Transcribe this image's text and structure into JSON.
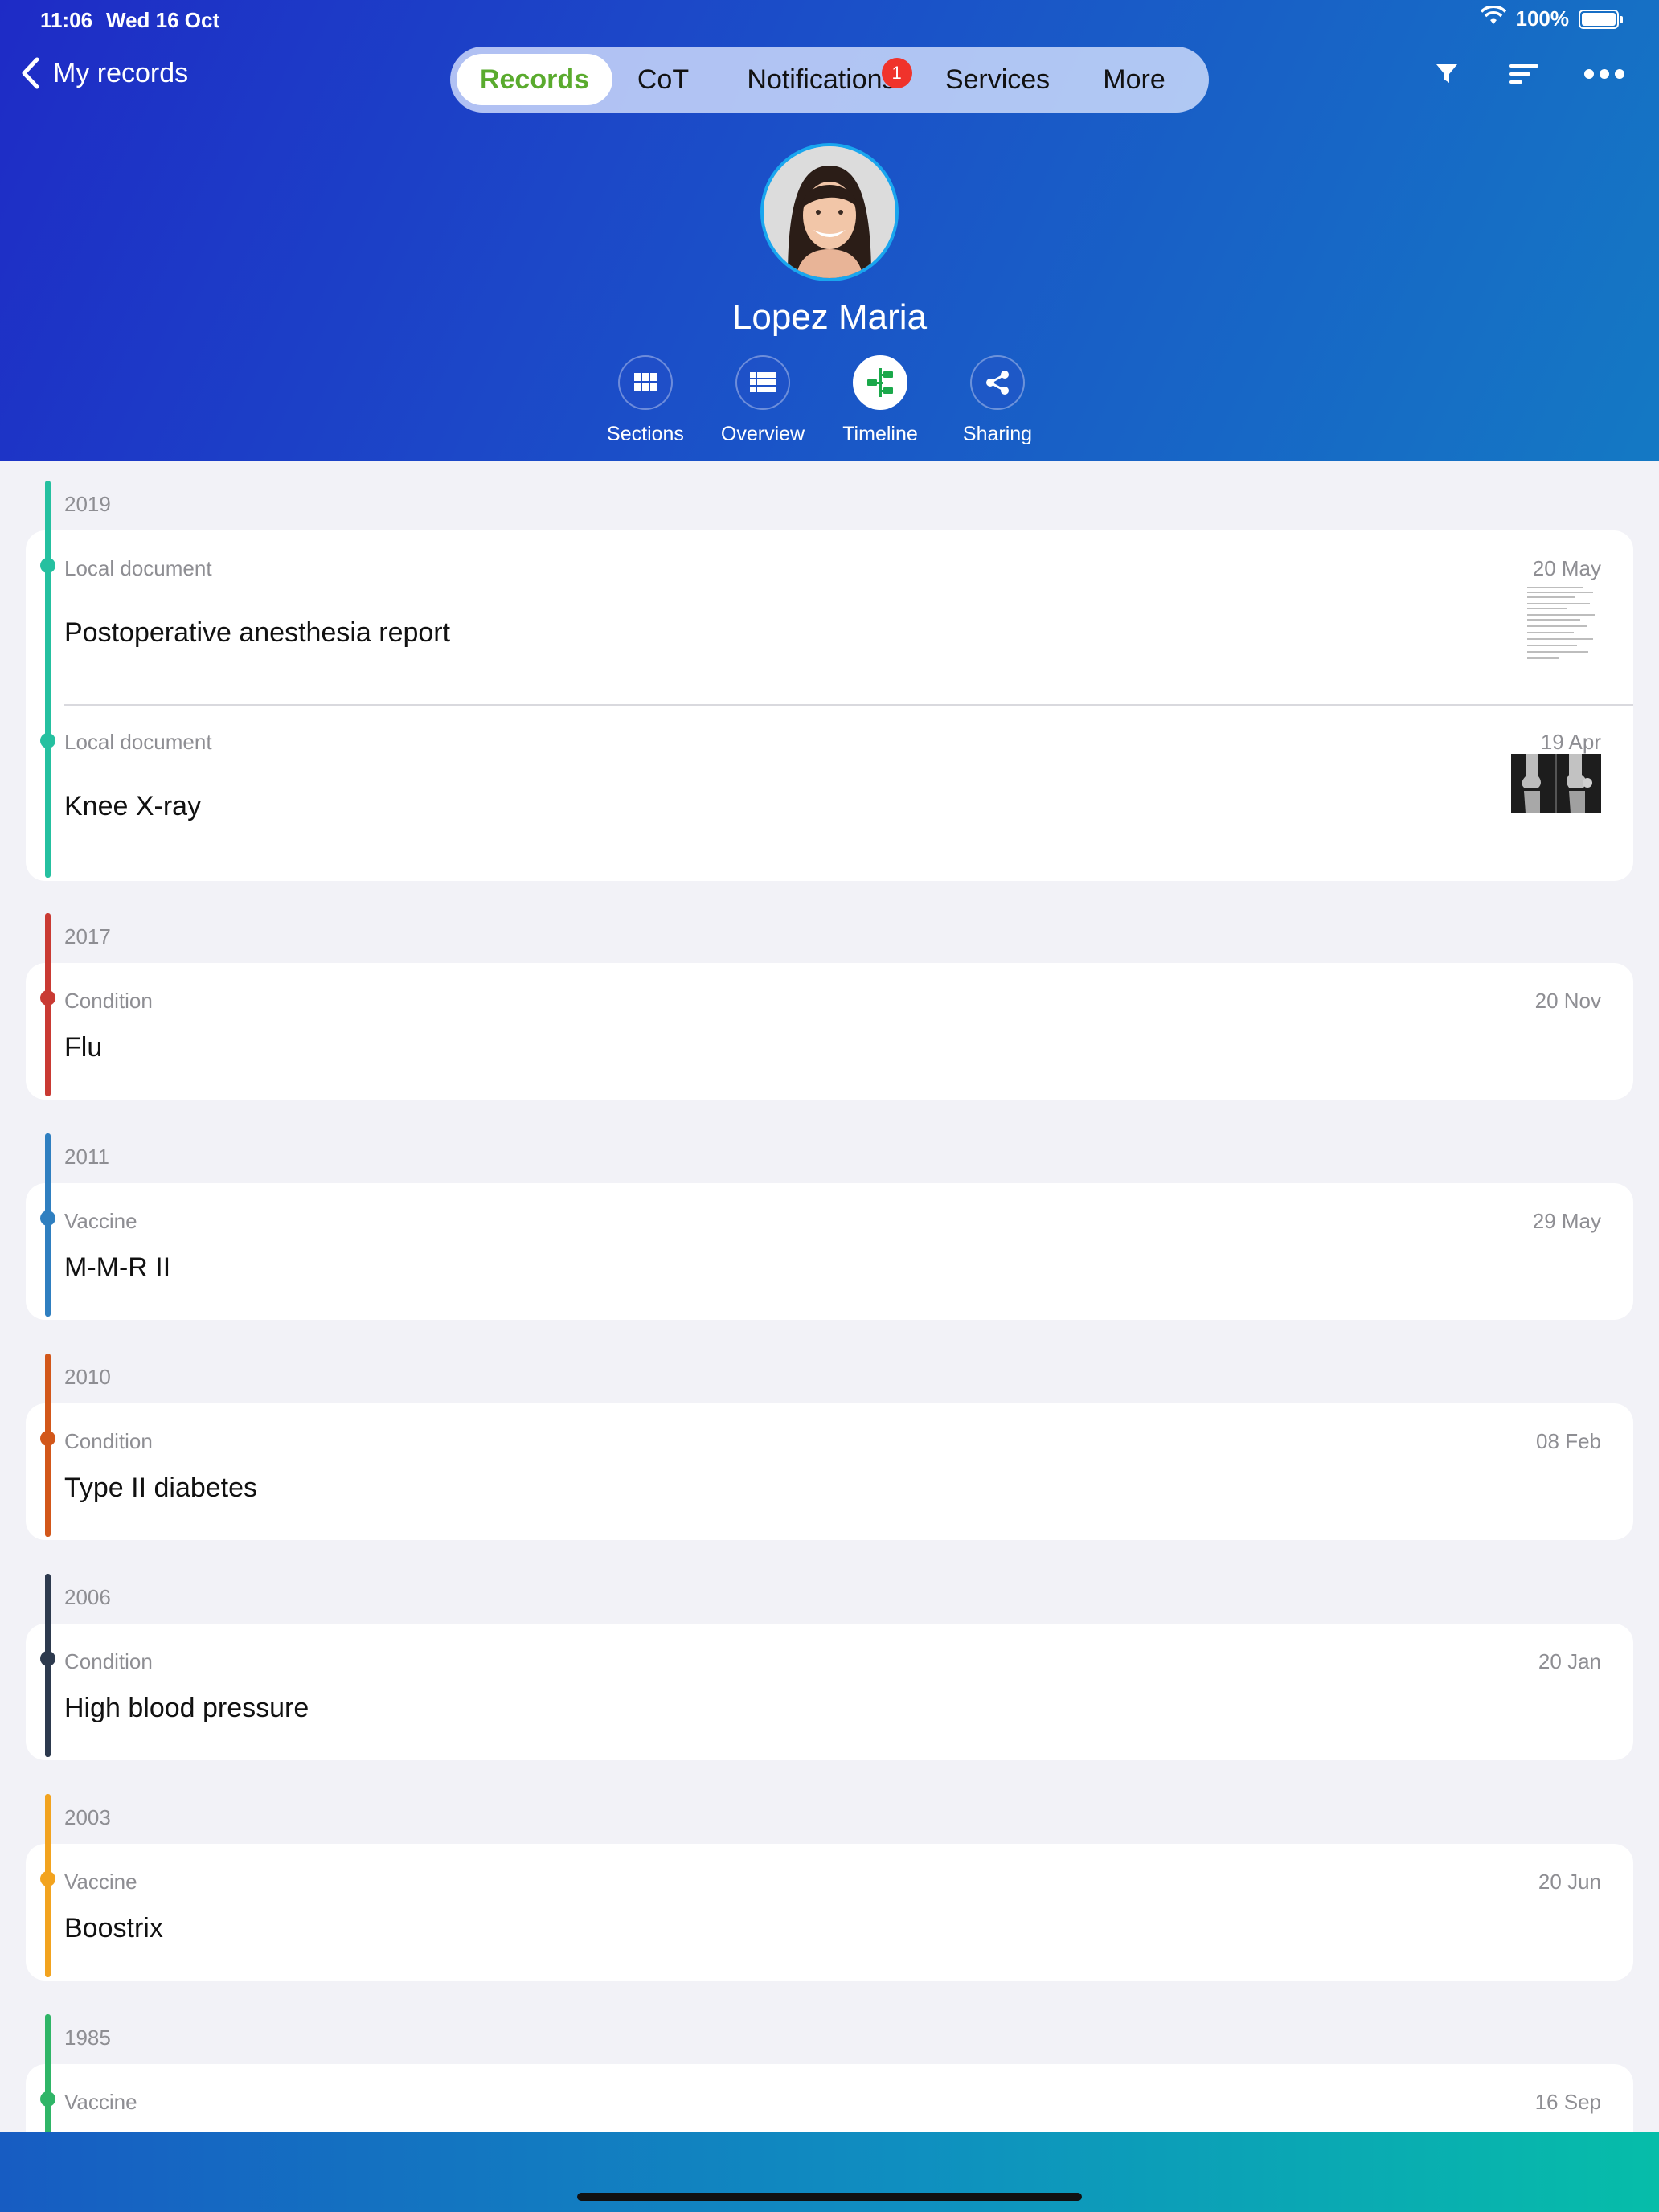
{
  "status_bar": {
    "time": "11:06",
    "date": "Wed 16 Oct",
    "battery": "100%"
  },
  "nav": {
    "back_label": "My records",
    "tabs": [
      {
        "label": "Records"
      },
      {
        "label": "CoT"
      },
      {
        "label": "Notifications",
        "badge": "1"
      },
      {
        "label": "Services"
      },
      {
        "label": "More"
      }
    ]
  },
  "patient": {
    "name": "Lopez Maria"
  },
  "views": [
    {
      "label": "Sections"
    },
    {
      "label": "Overview"
    },
    {
      "label": "Timeline"
    },
    {
      "label": "Sharing"
    }
  ],
  "timeline": [
    {
      "year": "2019",
      "color": "#25c0a0",
      "entries": [
        {
          "type": "Local document",
          "date": "20 May",
          "title": "Postoperative anesthesia report",
          "thumb": "document"
        },
        {
          "type": "Local document",
          "date": "19 Apr",
          "title": "Knee X-ray",
          "thumb": "xray"
        }
      ]
    },
    {
      "year": "2017",
      "color": "#c93a33",
      "entries": [
        {
          "type": "Condition",
          "date": "20 Nov",
          "title": "Flu"
        }
      ]
    },
    {
      "year": "2011",
      "color": "#2f7fc0",
      "entries": [
        {
          "type": "Vaccine",
          "date": "29 May",
          "title": "M-M-R II"
        }
      ]
    },
    {
      "year": "2010",
      "color": "#d2571a",
      "entries": [
        {
          "type": "Condition",
          "date": "08 Feb",
          "title": "Type II diabetes"
        }
      ]
    },
    {
      "year": "2006",
      "color": "#2d3a4e",
      "entries": [
        {
          "type": "Condition",
          "date": "20 Jan",
          "title": "High blood pressure"
        }
      ]
    },
    {
      "year": "2003",
      "color": "#f2a31f",
      "entries": [
        {
          "type": "Vaccine",
          "date": "20 Jun",
          "title": "Boostrix"
        }
      ]
    },
    {
      "year": "1985",
      "color": "#2fb567",
      "entries": [
        {
          "type": "Vaccine",
          "date": "16 Sep",
          "title": ""
        }
      ]
    }
  ]
}
